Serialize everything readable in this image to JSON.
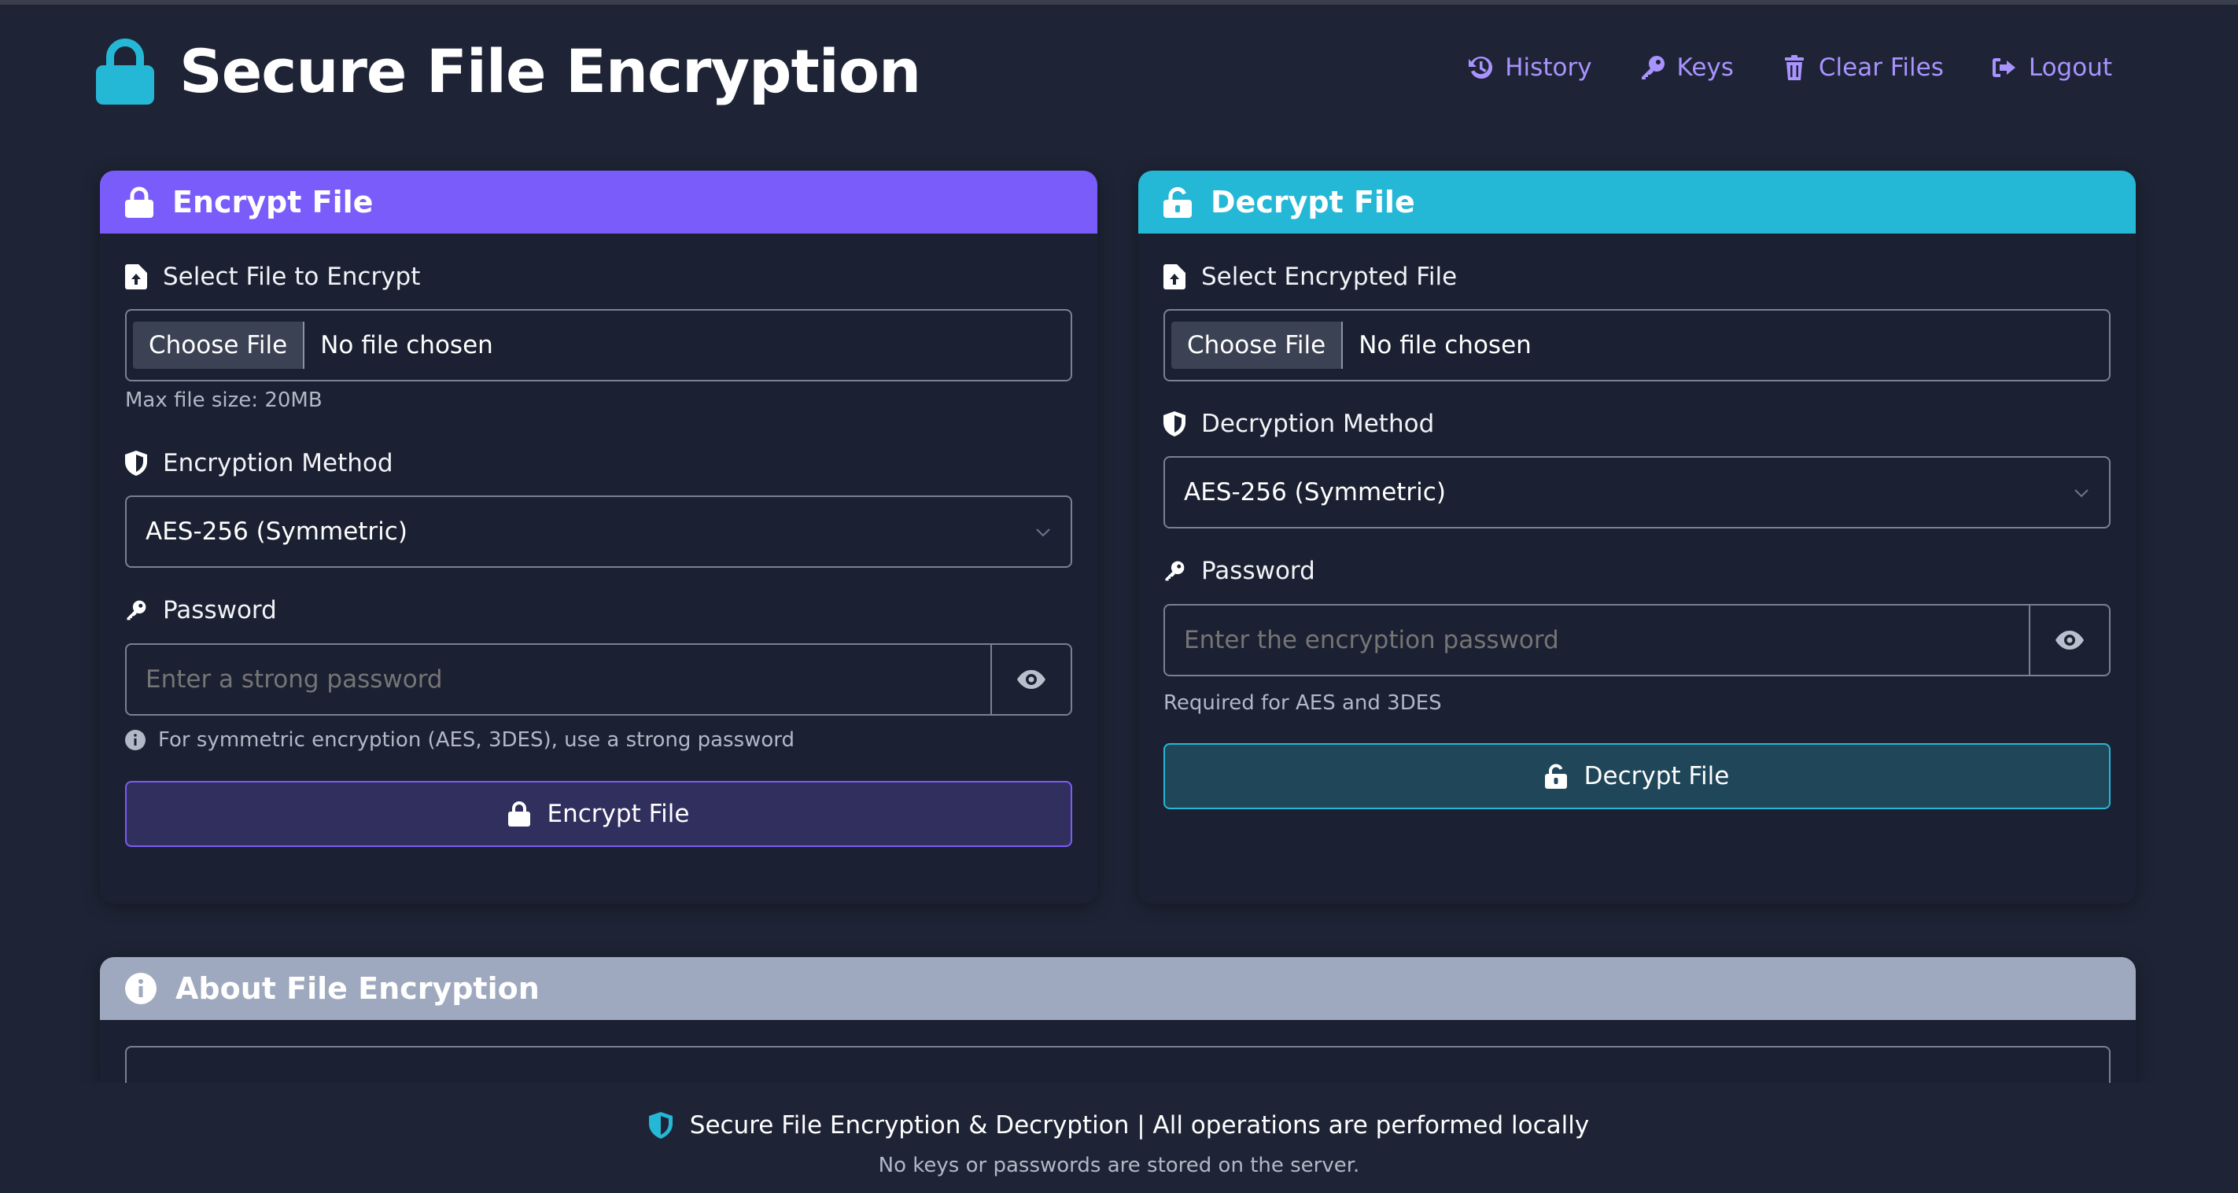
{
  "app": {
    "title": "Secure File Encryption",
    "brand_icon": "lock-icon",
    "colors": {
      "accent_purple": "#7a5cfa",
      "accent_cyan": "#25b8d6",
      "nav_link": "#a993ff",
      "background": "#1e2435"
    }
  },
  "nav": {
    "history": "History",
    "keys": "Keys",
    "clear_files": "Clear Files",
    "logout": "Logout"
  },
  "encrypt": {
    "title": "Encrypt File",
    "file_label": "Select File to Encrypt",
    "choose_file": "Choose File",
    "file_status": "No file chosen",
    "max_size": "Max file size: 20MB",
    "method_label": "Encryption Method",
    "method_value": "AES-256 (Symmetric)",
    "password_label": "Password",
    "password_placeholder": "Enter a strong password",
    "password_hint": "For symmetric encryption (AES, 3DES), use a strong password",
    "button": "Encrypt File"
  },
  "decrypt": {
    "title": "Decrypt File",
    "file_label": "Select Encrypted File",
    "choose_file": "Choose File",
    "file_status": "No file chosen",
    "method_label": "Decryption Method",
    "method_value": "AES-256 (Symmetric)",
    "password_label": "Password",
    "password_placeholder": "Enter the encryption password",
    "password_hint": "Required for AES and 3DES",
    "button": "Decrypt File"
  },
  "about": {
    "title": "About File Encryption"
  },
  "footer": {
    "main": "Secure File Encryption & Decryption | All operations are performed locally",
    "sub": "No keys or passwords are stored on the server."
  }
}
